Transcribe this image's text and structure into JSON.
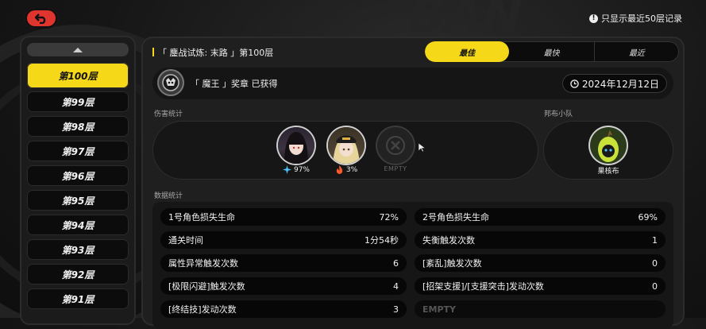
{
  "header": {
    "back_icon": "back-arrow-icon",
    "record_note": "只显示最近50层记录"
  },
  "floors": {
    "items": [
      "第100层",
      "第99层",
      "第98层",
      "第97层",
      "第96层",
      "第95层",
      "第94层",
      "第93层",
      "第92层",
      "第91层"
    ],
    "selected": "第100层"
  },
  "stage": {
    "title": "「 鏖战试炼: 末路 」第100层",
    "tabs": [
      "最佳",
      "最快",
      "最近"
    ],
    "active_tab": "最佳"
  },
  "medal": {
    "text": "「 魔王 」奖章 已获得",
    "date": "2024年12月12日"
  },
  "damage_section": {
    "label": "伤害统计",
    "agents": [
      {
        "percent": "97%",
        "element": "ice-icon",
        "color": "#4fc3f7"
      },
      {
        "percent": "3%",
        "element": "fire-icon",
        "color": "#ff5a2a"
      }
    ],
    "empty_label": "EMPTY"
  },
  "bangboo_section": {
    "label": "邦布小队",
    "name": "果核布"
  },
  "stats_section": {
    "label": "数据统计",
    "rows": [
      {
        "label": "1号角色损失生命",
        "value": "72%"
      },
      {
        "label": "2号角色损失生命",
        "value": "69%"
      },
      {
        "label": "通关时间",
        "value": "1分54秒"
      },
      {
        "label": "失衡触发次数",
        "value": "1"
      },
      {
        "label": "属性异常触发次数",
        "value": "6"
      },
      {
        "label": "[紊乱]触发次数",
        "value": "0"
      },
      {
        "label": "[极限闪避]触发次数",
        "value": "4"
      },
      {
        "label": "[招架支援]/[支援突击]发动次数",
        "value": "0"
      },
      {
        "label": "[终结技]发动次数",
        "value": "3"
      },
      {
        "label": "EMPTY",
        "value": ""
      }
    ]
  },
  "colors": {
    "accent": "#f5d817",
    "back_button": "#e0342f"
  }
}
